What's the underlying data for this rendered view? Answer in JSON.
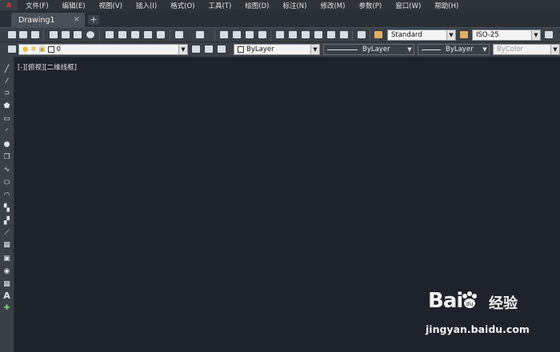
{
  "app": {
    "logo_text": "A"
  },
  "menu": [
    "文件(F)",
    "编辑(E)",
    "视图(V)",
    "插入(I)",
    "格式(O)",
    "工具(T)",
    "绘图(D)",
    "标注(N)",
    "修改(M)",
    "参数(P)",
    "窗口(W)",
    "帮助(H)"
  ],
  "tabs": {
    "document": "Drawing1",
    "close": "×",
    "new": "+"
  },
  "toolbar": {
    "text_style": "Standard",
    "dim_style": "ISO-25",
    "layer": "0",
    "color": "ByLayer",
    "linetype": "ByLayer",
    "lineweight": "ByLayer",
    "plot_style": "ByColor"
  },
  "viewport": {
    "label": "[-][俯视][二维线框]"
  },
  "watermark": {
    "logo": "Bai",
    "logo_cn": "经验",
    "url": "jingyan.baidu.com"
  }
}
